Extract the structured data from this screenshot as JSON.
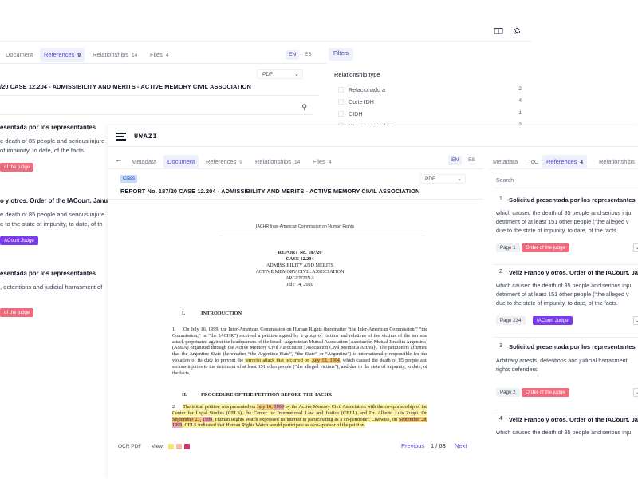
{
  "back_window": {
    "tabs": [
      {
        "label": "Document",
        "count": ""
      },
      {
        "label": "References",
        "count": "9"
      },
      {
        "label": "Relationships",
        "count": "14"
      },
      {
        "label": "Files",
        "count": "4"
      }
    ],
    "langs": [
      "EN",
      "ES"
    ],
    "doc_title": "/20 CASE 12.204 - ADMISSIBILITY AND MERITS - ACTIVE MEMORY CIVIL ASSOCIATION",
    "pdf_select": "PDF",
    "filters_label": "Filters",
    "relationship_type_label": "Relationship type",
    "filter_items": [
      {
        "label": "Relacionado a",
        "count": "2"
      },
      {
        "label": "Corte IDH",
        "count": "4"
      },
      {
        "label": "CIDH",
        "count": "1"
      },
      {
        "label": "Votos separados",
        "count": "2"
      }
    ],
    "references": [
      {
        "heading": "esentada por los representantes",
        "line1": "e death of 85 people and serious injure",
        "line2": "of impunity, to date, of the facts.",
        "pill": "of the judge"
      },
      {
        "heading": "o y otros. Order of the IACourt. January",
        "line1": "e death of 85 people and serious injure",
        "line2": "e to the state of impunity, to date, of th",
        "pill": "ACourt Judge"
      },
      {
        "heading": "esentada por los representantes",
        "line1": ", detentions and judicial harrasment of",
        "line2": "",
        "pill": "of the judge"
      }
    ]
  },
  "front_window": {
    "logo": "UWAZI",
    "tabs": [
      {
        "label": "Metadata",
        "count": ""
      },
      {
        "label": "Document",
        "count": ""
      },
      {
        "label": "References",
        "count": "9"
      },
      {
        "label": "Relationships",
        "count": "14"
      },
      {
        "label": "Files",
        "count": "4"
      }
    ],
    "langs": [
      "EN",
      "ES"
    ],
    "class_badge": "Class",
    "pdf_select": "PDF",
    "doc_title": "REPORT No. 187/20 CASE 12.204 - ADMISSIBILITY AND MERITS - ACTIVE MEMORY CIVIL ASSOCIATION",
    "document": {
      "org": "IACHR Inter-American Commission on Human Rights",
      "report_no": "REPORT No. 187/20",
      "case": "CASE 12.204",
      "subtitle1": "ADMISSIBILITY AND MERITS",
      "subtitle2": "ACTIVE MEMORY CIVIL ASSOCIATION",
      "country": "ARGENTINA",
      "date": "July 14, 2020",
      "section1_num": "I.",
      "section1": "INTRODUCTION",
      "section2_num": "II.",
      "section2": "PROCEDURE OF THE PETITION BEFORE THE IACHR",
      "p1_num": "1.",
      "p1_a": "On July 16, 1999, the Inter-American Commission on Human Rights (hereinafter “the Inter-American Commission,” “the Commission,” or “the IACHR”) received a petition signed by a group of victims and relatives of the victims of the terrorist attack perpetrated against the headquarters of the Israeli-Argentinian Mutual Association [Asociación Mutual Israelita Argentina](AMIA) organized through the Active Memory Civil Association [Asociación Civil Memoria Activa]¹. The petitioners affirmed that the Argentine State (hereinafter “the Argentine State”, “the State” or “Argentina”) is internationally responsible for the violation of its duty to prevent the ",
      "p1_hl1": "terrorist attack that occurred on ",
      "p1_hl2": "July 18, 1994",
      "p1_b": ", which caused the death of 85 people and serious injuries to the detriment of at least 151 other people (“the alleged victims”), and due to the state of impunity, to date, of the facts.",
      "p2_num": "2.",
      "p2_a": "The initial petition was presented on ",
      "p2_d1": "July 16, ",
      "p2_d1b": "1999",
      "p2_b": " by the Active Memory Civil Association with the co-sponsorship of the Center for Legal Studies (CELS), the Center for International Law and Justice (CEJIL) and Dr. Alberto Luis Zuppi. On ",
      "p2_d2": "September 23, ",
      "p2_d2b": "1999",
      "p2_c": ", Human Rights Watch expressed its interest in participating as a co-petitioner. Likewise, on ",
      "p2_d3": "September 28, ",
      "p2_d3b": "1999",
      "p2_d": ", CELS indicated that Human Rights Watch would participate as a co-sponsor of the petition."
    },
    "footer": {
      "ocr": "OCR PDF",
      "view": "View:",
      "previous": "Previous",
      "page": "1 / 63",
      "next": "Next",
      "swatches": [
        "#f8e27a",
        "#f6b8a8",
        "#d6336c"
      ]
    },
    "side_tabs": [
      {
        "label": "Metadata",
        "count": ""
      },
      {
        "label": "ToC",
        "count": ""
      },
      {
        "label": "References",
        "count": "4"
      },
      {
        "label": "Relationships",
        "count": ""
      }
    ],
    "search_placeholder": "Search",
    "references": [
      {
        "num": "1",
        "heading": "Solicitud presentada por los representantes",
        "line1": "which caused the death of 85 people and serious inju",
        "line2": "detriment of at least 151 other people (“the alleged v",
        "line3": "due to the state of impunity, to date, of the facts.",
        "page": "Page 1",
        "pill": "Order of the judge",
        "pill_color": "#f06a7d"
      },
      {
        "num": "2",
        "heading": "Veliz Franco y otros. Order of the IACourt. Janu",
        "line1": "which caused the death of 85 people and serious inju",
        "line2": "detriment of at least 151 other people (“the alleged v",
        "line3": "due to the state of impunity, to date, of the facts.",
        "page": "Page 234",
        "pill": "IACourt Judge",
        "pill_color": "#7c3aed"
      },
      {
        "num": "3",
        "heading": "Solicitud presentada por los representantes",
        "line1": "Arbitrary arrests, detentions and judicial harrasment",
        "line2": "rights defenders.",
        "line3": "",
        "page": "Page 2",
        "pill": "Order of the judge",
        "pill_color": "#f06a7d"
      },
      {
        "num": "4",
        "heading": "Veliz Franco y otros. Order of the IACourt. Janu",
        "line1": "which caused the death of 85 people and serious inju",
        "line2": "",
        "line3": "",
        "page": "",
        "pill": "",
        "pill_color": ""
      }
    ]
  }
}
